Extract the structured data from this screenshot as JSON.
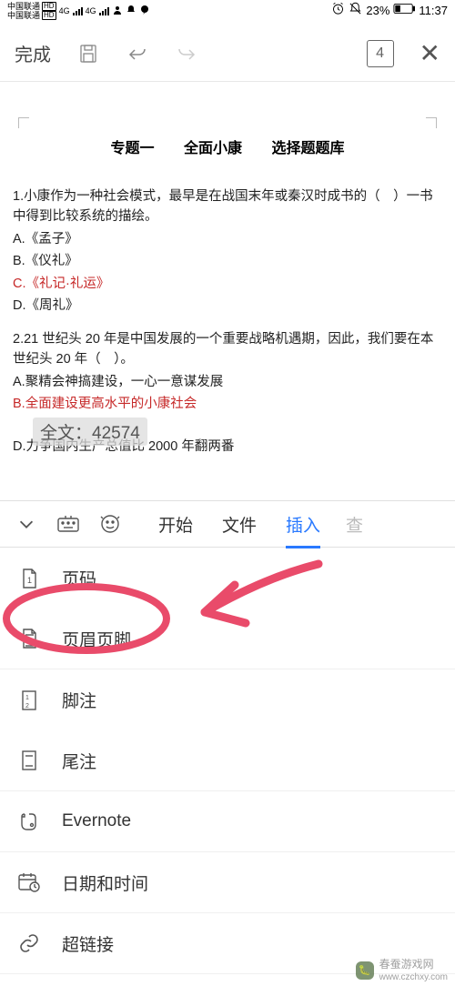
{
  "status": {
    "carrier1": "中国联通",
    "carrier2": "中国联通",
    "net": "4G",
    "battery": "23%",
    "time": "11:37"
  },
  "toolbar": {
    "done": "完成",
    "page_num": "4"
  },
  "doc": {
    "title1": "专题一",
    "title2": "全面小康",
    "title3": "选择题题库",
    "q1": "1.小康作为一种社会模式，最早是在战国末年或秦汉时成书的（　）一书中得到比较系统的描绘。",
    "q1a": "A.《孟子》",
    "q1b": "B.《仪礼》",
    "q1c": "C.《礼记·礼运》",
    "q1d": "D.《周礼》",
    "q2": "2.21 世纪头 20 年是中国发展的一个重要战略机遇期，因此，我们要在本世纪头 20 年（　）。",
    "q2a": "A.聚精会神搞建设，一心一意谋发展",
    "q2b": "B.全面建设更高水平的小康社会",
    "q2d": "D.力争国内生产总值比 2000 年翻两番",
    "word_count": "全文：42574"
  },
  "tabs": {
    "start": "开始",
    "file": "文件",
    "insert": "插入",
    "peek": "查"
  },
  "menu": {
    "page_number": "页码",
    "header_footer": "页眉页脚",
    "footnote": "脚注",
    "endnote": "尾注",
    "evernote": "Evernote",
    "datetime": "日期和时间",
    "hyperlink": "超链接"
  },
  "watermark": {
    "name": "春蚕游戏网",
    "url": "www.czchxy.com"
  }
}
